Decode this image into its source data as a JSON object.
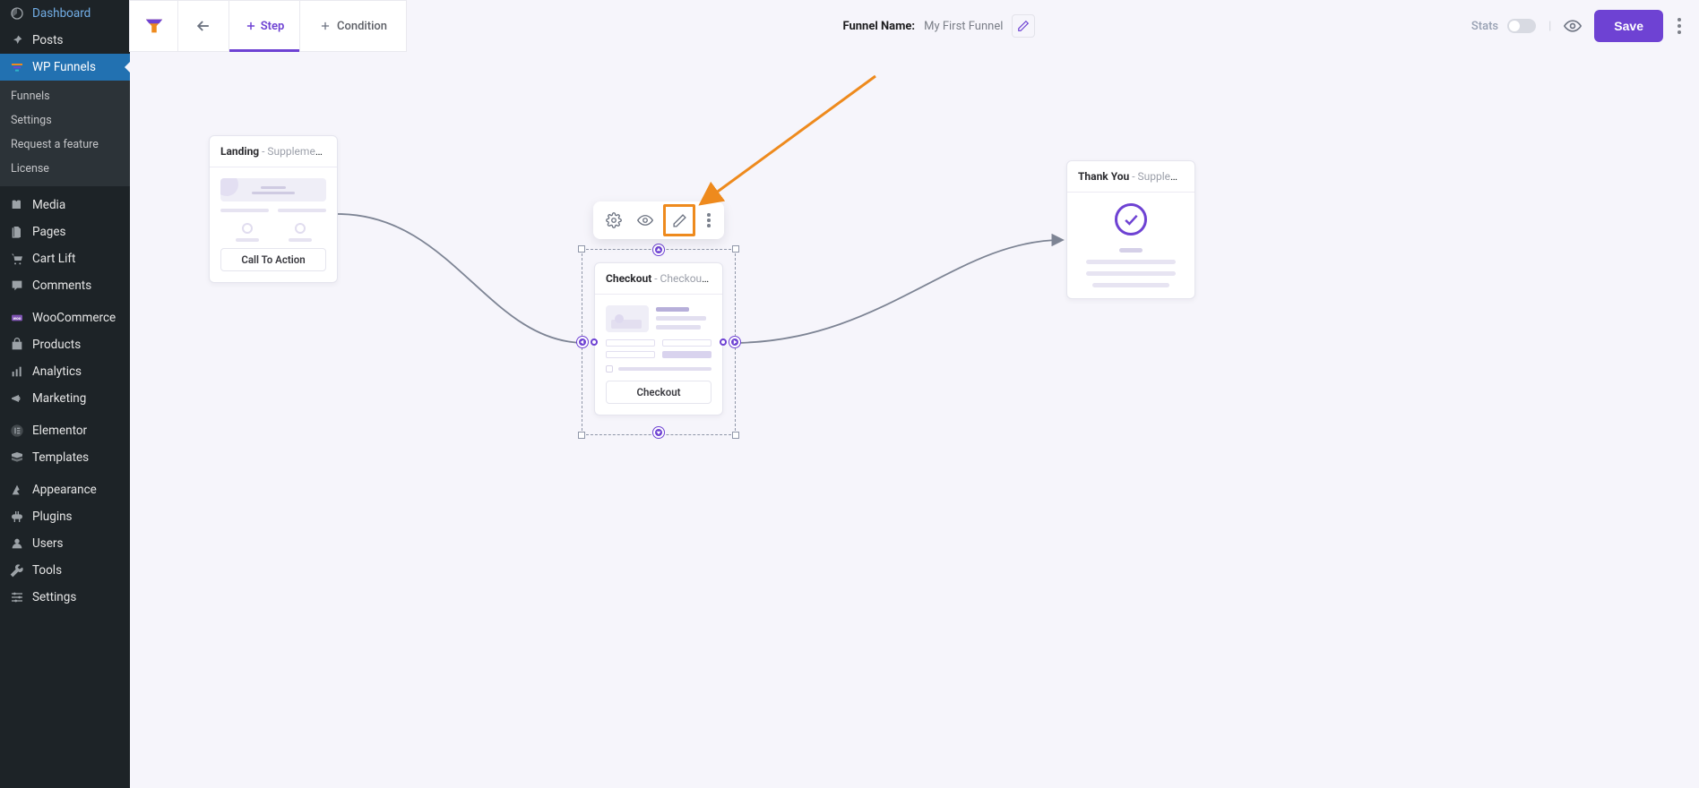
{
  "sidebar": {
    "items": [
      {
        "label": "Dashboard",
        "icon": "gauge"
      },
      {
        "label": "Posts",
        "icon": "pin"
      },
      {
        "label": "WP Funnels",
        "icon": "funnels",
        "active": true
      },
      {
        "label": "Media",
        "icon": "media",
        "sep": true
      },
      {
        "label": "Pages",
        "icon": "pages"
      },
      {
        "label": "Cart Lift",
        "icon": "cartlift"
      },
      {
        "label": "Comments",
        "icon": "comment"
      },
      {
        "label": "WooCommerce",
        "icon": "woo",
        "sep": true
      },
      {
        "label": "Products",
        "icon": "products"
      },
      {
        "label": "Analytics",
        "icon": "analytics"
      },
      {
        "label": "Marketing",
        "icon": "marketing"
      },
      {
        "label": "Elementor",
        "icon": "elementor",
        "sep": true
      },
      {
        "label": "Templates",
        "icon": "templates"
      },
      {
        "label": "Appearance",
        "icon": "appearance",
        "sep": true
      },
      {
        "label": "Plugins",
        "icon": "plugins"
      },
      {
        "label": "Users",
        "icon": "users"
      },
      {
        "label": "Tools",
        "icon": "tools"
      },
      {
        "label": "Settings",
        "icon": "settings"
      }
    ],
    "submenu": [
      {
        "label": "Funnels"
      },
      {
        "label": "Settings"
      },
      {
        "label": "Request a feature"
      },
      {
        "label": "License"
      }
    ]
  },
  "topbar": {
    "step_label": "Step",
    "condition_label": "Condition",
    "funnel_name_label": "Funnel Name:",
    "funnel_name_value": "My First Funnel",
    "stats_label": "Stats",
    "save_label": "Save"
  },
  "nodes": {
    "landing": {
      "title": "Landing",
      "subtitle": " - Supplement La…",
      "cta": "Call To Action"
    },
    "checkout": {
      "title": "Checkout",
      "subtitle": " - Checkout Step",
      "cta": "Checkout"
    },
    "thankyou": {
      "title": "Thank You",
      "subtitle": " - Supplement T…"
    }
  }
}
